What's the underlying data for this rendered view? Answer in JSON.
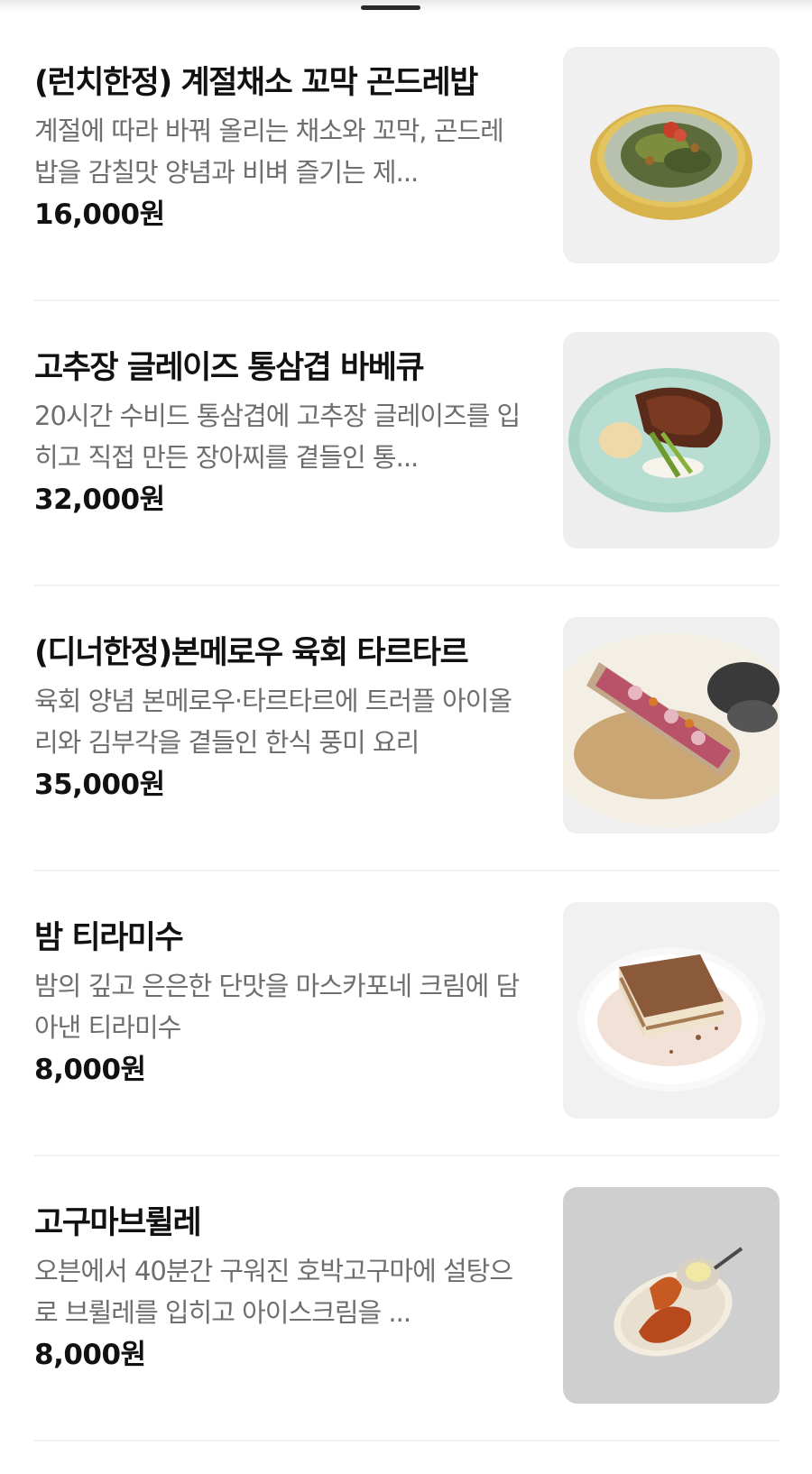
{
  "menu": {
    "items": [
      {
        "name": "(런치한정) 계절채소 꼬막 곤드레밥",
        "description": "계절에 따라 바꿔 올리는 채소와 꼬막, 곤드레밥을 감칠맛 양념과 비벼 즐기는 제...",
        "price": "16,000원",
        "image_alt": "seasonal vegetables and cockle gondre rice bowl"
      },
      {
        "name": "고추장 글레이즈 통삼겹 바베큐",
        "description": "20시간 수비드 통삼겹에 고추장 글레이즈를 입히고 직접 만든 장아찌를 곁들인 통...",
        "price": "32,000원",
        "image_alt": "gochujang glazed pork belly barbecue"
      },
      {
        "name": "(디너한정)본메로우 육회 타르타르",
        "description": "육회 양념 본메로우·타르타르에 트러플 아이올리와 김부각을 곁들인 한식 풍미 요리",
        "price": "35,000원",
        "image_alt": "bone marrow yukhoe tartare"
      },
      {
        "name": "밤 티라미수",
        "description": "밤의 깊고 은은한 단맛을 마스카포네 크림에 담아낸 티라미수",
        "price": "8,000원",
        "image_alt": "chestnut tiramisu"
      },
      {
        "name": "고구마브륄레",
        "description": "오븐에서 40분간 구워진 호박고구마에 설탕으로 브륄레를 입히고 아이스크림을 ...",
        "price": "8,000원",
        "image_alt": "sweet potato brulee with ice cream"
      }
    ]
  }
}
